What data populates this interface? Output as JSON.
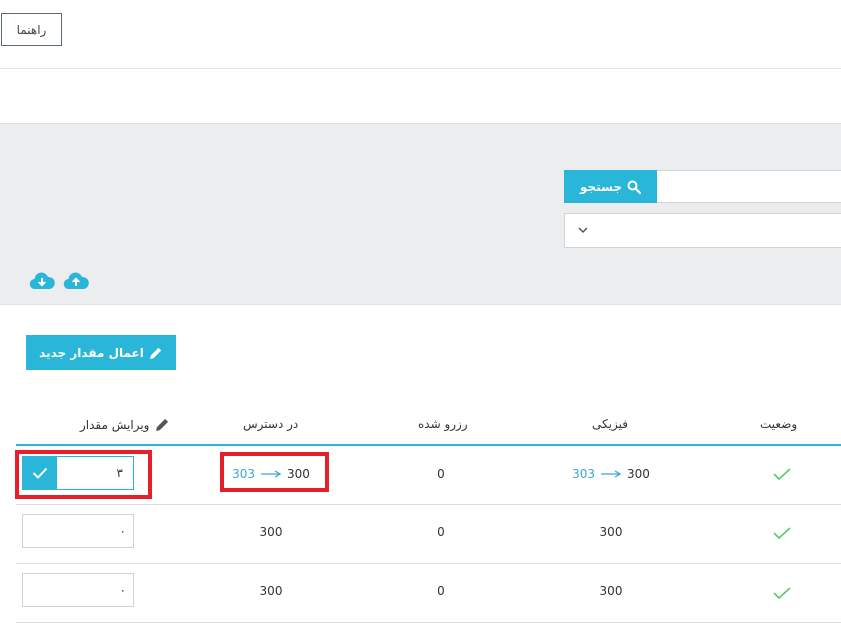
{
  "header": {
    "help_label": "راهنما"
  },
  "search": {
    "button_label": "جستجو",
    "input_value": ""
  },
  "filter": {
    "select_value": ""
  },
  "actions": {
    "apply_new_value_label": "اعمال مقدار جدید"
  },
  "table": {
    "headers": {
      "status": "وضعیت",
      "physical": "فیزیکی",
      "reserved": "رزرو شده",
      "available": "در دسترس",
      "edit_quantity": "ویرایش مقدار"
    },
    "rows": [
      {
        "physical_old": "300",
        "physical_new": "303",
        "reserved": "0",
        "available_old": "300",
        "available_new": "303",
        "edit_value": "۳"
      },
      {
        "physical": "300",
        "reserved": "0",
        "available": "300",
        "edit_value": "۰"
      },
      {
        "physical": "300",
        "reserved": "0",
        "available": "300",
        "edit_value": "۰"
      }
    ]
  },
  "colors": {
    "accent": "#29b6d9",
    "check": "#5cc86b",
    "highlight": "#e5202a",
    "panel": "#ebedef"
  },
  "icons": {
    "search": "search-icon",
    "chevron": "chevron-down-icon",
    "download": "cloud-download-icon",
    "upload": "cloud-upload-icon",
    "pencil": "pencil-icon",
    "check": "check-icon",
    "arrow": "arrow-right-icon"
  }
}
